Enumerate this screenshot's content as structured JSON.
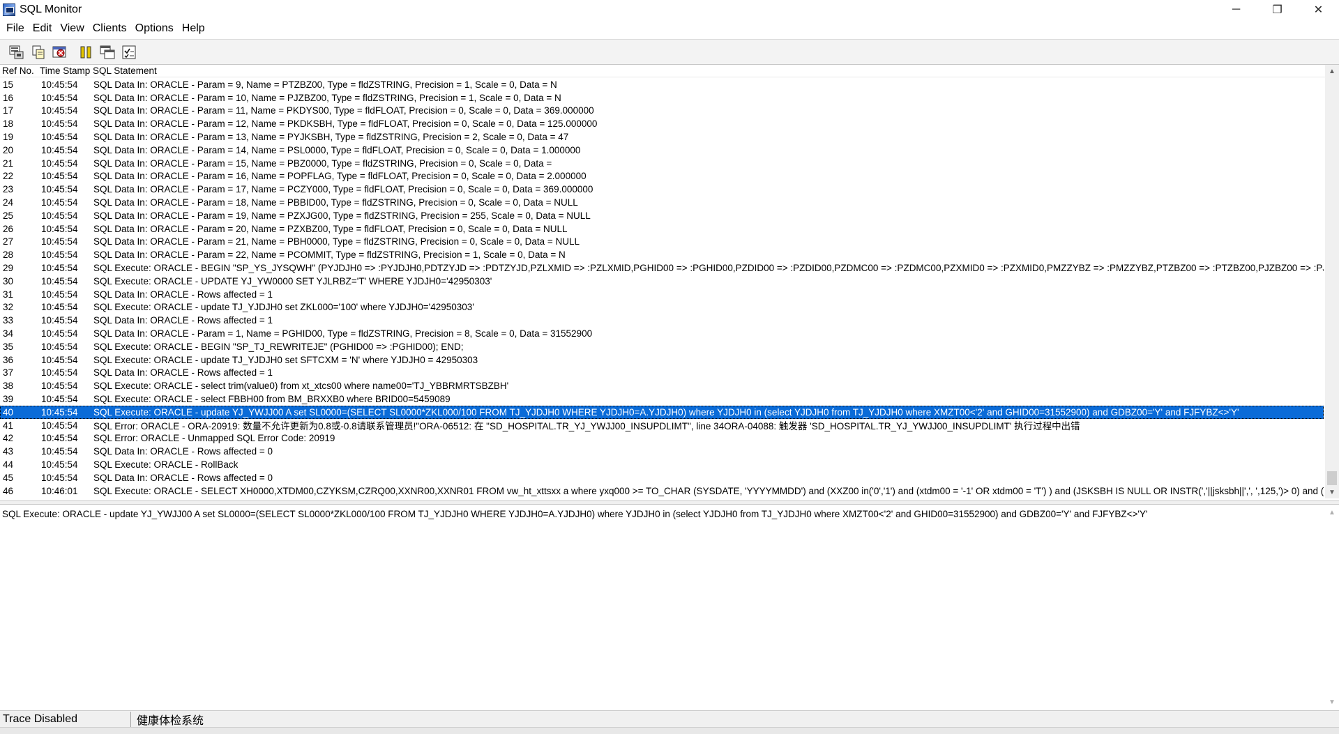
{
  "window": {
    "title": "SQL Monitor",
    "minimize": "─",
    "restore": "❐",
    "close": "✕"
  },
  "menu": [
    "File",
    "Edit",
    "View",
    "Clients",
    "Options",
    "Help"
  ],
  "toolbar": {
    "icons": [
      "save-log-icon",
      "copy-icon",
      "clear-icon",
      "pause-icon",
      "window-icon",
      "options-icon"
    ]
  },
  "list": {
    "columns": {
      "ref": "Ref No.",
      "time": "Time Stamp",
      "sql": "SQL Statement"
    },
    "rows": [
      {
        "ref": "15",
        "time": "10:45:54",
        "sql": "SQL Data In: ORACLE - Param = 9, Name = PTZBZ00, Type = fldZSTRING, Precision = 1, Scale = 0, Data = N"
      },
      {
        "ref": "16",
        "time": "10:45:54",
        "sql": "SQL Data In: ORACLE - Param = 10, Name = PJZBZ00, Type = fldZSTRING, Precision = 1, Scale = 0, Data = N"
      },
      {
        "ref": "17",
        "time": "10:45:54",
        "sql": "SQL Data In: ORACLE - Param = 11, Name = PKDYS00, Type = fldFLOAT, Precision = 0, Scale = 0, Data = 369.000000"
      },
      {
        "ref": "18",
        "time": "10:45:54",
        "sql": "SQL Data In: ORACLE - Param = 12, Name = PKDKSBH, Type = fldFLOAT, Precision = 0, Scale = 0, Data = 125.000000"
      },
      {
        "ref": "19",
        "time": "10:45:54",
        "sql": "SQL Data In: ORACLE - Param = 13, Name = PYJKSBH, Type = fldZSTRING, Precision = 2, Scale = 0, Data = 47"
      },
      {
        "ref": "20",
        "time": "10:45:54",
        "sql": "SQL Data In: ORACLE - Param = 14, Name = PSL0000, Type = fldFLOAT, Precision = 0, Scale = 0, Data = 1.000000"
      },
      {
        "ref": "21",
        "time": "10:45:54",
        "sql": "SQL Data In: ORACLE - Param = 15, Name = PBZ0000, Type = fldZSTRING, Precision = 0, Scale = 0, Data ="
      },
      {
        "ref": "22",
        "time": "10:45:54",
        "sql": "SQL Data In: ORACLE - Param = 16, Name = POPFLAG, Type = fldFLOAT, Precision = 0, Scale = 0, Data = 2.000000"
      },
      {
        "ref": "23",
        "time": "10:45:54",
        "sql": "SQL Data In: ORACLE - Param = 17, Name = PCZY000, Type = fldFLOAT, Precision = 0, Scale = 0, Data = 369.000000"
      },
      {
        "ref": "24",
        "time": "10:45:54",
        "sql": "SQL Data In: ORACLE - Param = 18, Name = PBBID00, Type = fldZSTRING, Precision = 0, Scale = 0, Data = NULL"
      },
      {
        "ref": "25",
        "time": "10:45:54",
        "sql": "SQL Data In: ORACLE - Param = 19, Name = PZXJG00, Type = fldZSTRING, Precision = 255, Scale = 0, Data = NULL"
      },
      {
        "ref": "26",
        "time": "10:45:54",
        "sql": "SQL Data In: ORACLE - Param = 20, Name = PZXBZ00, Type = fldFLOAT, Precision = 0, Scale = 0, Data = NULL"
      },
      {
        "ref": "27",
        "time": "10:45:54",
        "sql": "SQL Data In: ORACLE - Param = 21, Name = PBH0000, Type = fldZSTRING, Precision = 0, Scale = 0, Data = NULL"
      },
      {
        "ref": "28",
        "time": "10:45:54",
        "sql": "SQL Data In: ORACLE - Param = 22, Name = PCOMMIT, Type = fldZSTRING, Precision = 1, Scale = 0, Data = N"
      },
      {
        "ref": "29",
        "time": "10:45:54",
        "sql": "SQL Execute: ORACLE - BEGIN \"SP_YS_JYSQWH\" (PYJDJH0 => :PYJDJH0,PDTZYJD => :PDTZYJD,PZLXMID => :PZLXMID,PGHID00 => :PGHID00,PZDID00 => :PZDID00,PZDMC00 => :PZDMC00,PZXMID0 => :PZXMID0,PMZZYBZ => :PMZZYBZ,PTZBZ00 => :PTZBZ00,PJZBZ00 => :PJZ"
      },
      {
        "ref": "30",
        "time": "10:45:54",
        "sql": "SQL Execute: ORACLE - UPDATE YJ_YW0000 SET YJLRBZ='T' WHERE YJDJH0='42950303'"
      },
      {
        "ref": "31",
        "time": "10:45:54",
        "sql": "SQL Data In: ORACLE - Rows affected = 1"
      },
      {
        "ref": "32",
        "time": "10:45:54",
        "sql": "SQL Execute: ORACLE - update TJ_YJDJH0 set ZKL000='100' where YJDJH0='42950303'"
      },
      {
        "ref": "33",
        "time": "10:45:54",
        "sql": "SQL Data In: ORACLE - Rows affected = 1"
      },
      {
        "ref": "34",
        "time": "10:45:54",
        "sql": "SQL Data In: ORACLE - Param = 1, Name = PGHID00, Type = fldZSTRING, Precision = 8, Scale = 0, Data = 31552900"
      },
      {
        "ref": "35",
        "time": "10:45:54",
        "sql": "SQL Execute: ORACLE - BEGIN \"SP_TJ_REWRITEJE\" (PGHID00 => :PGHID00); END;"
      },
      {
        "ref": "36",
        "time": "10:45:54",
        "sql": "SQL Execute: ORACLE - update TJ_YJDJH0 set SFTCXM = 'N' where YJDJH0 = 42950303"
      },
      {
        "ref": "37",
        "time": "10:45:54",
        "sql": "SQL Data In: ORACLE - Rows affected = 1"
      },
      {
        "ref": "38",
        "time": "10:45:54",
        "sql": "SQL Execute: ORACLE - select trim(value0) from xt_xtcs00 where name00='TJ_YBBRMRTSBZBH'"
      },
      {
        "ref": "39",
        "time": "10:45:54",
        "sql": "SQL Execute: ORACLE - select FBBH00 from BM_BRXXB0 where BRID00=5459089"
      },
      {
        "ref": "40",
        "time": "10:45:54",
        "sql": "SQL Execute: ORACLE -  update YJ_YWJJ00 A set SL0000=(SELECT SL0000*ZKL000/100 FROM TJ_YJDJH0 WHERE YJDJH0=A.YJDJH0)  where YJDJH0 in (select YJDJH0 from TJ_YJDJH0 where XMZT00<'2' and GHID00=31552900)    and GDBZ00='Y' and FJFYBZ<>'Y'"
      },
      {
        "ref": "41",
        "time": "10:45:54",
        "sql": "SQL Error: ORACLE - ORA-20919: 数量不允许更新为0.8或-0.8请联系管理员!\"ORA-06512: 在 \"SD_HOSPITAL.TR_YJ_YWJJ00_INSUPDLIMT\", line 34ORA-04088: 触发器 'SD_HOSPITAL.TR_YJ_YWJJ00_INSUPDLIMT' 执行过程中出错"
      },
      {
        "ref": "42",
        "time": "10:45:54",
        "sql": "SQL Error: ORACLE - Unmapped SQL Error Code: 20919"
      },
      {
        "ref": "43",
        "time": "10:45:54",
        "sql": "SQL Data In: ORACLE - Rows affected = 0"
      },
      {
        "ref": "44",
        "time": "10:45:54",
        "sql": "SQL Execute: ORACLE - RollBack"
      },
      {
        "ref": "45",
        "time": "10:45:54",
        "sql": "SQL Data In: ORACLE - Rows affected = 0"
      },
      {
        "ref": "46",
        "time": "10:46:01",
        "sql": "SQL Execute: ORACLE - SELECT XH0000,XTDM00,CZYKSM,CZRQ00,XXNR00,XXNR01 FROM vw_ht_xttsxx a where yxq000 >= TO_CHAR (SYSDATE, 'YYYYMMDD') and (XXZ00 in('0','1') and (xtdm00 = '-1' OR xtdm00 = 'T') ) and (JSKSBH IS NULL OR INSTR(','||jsksbh||',', ',125,')> 0) and (JSF"
      }
    ],
    "selected_ref": "40"
  },
  "detail": {
    "text": "SQL Execute: ORACLE -  update YJ_YWJJ00 A set SL0000=(SELECT SL0000*ZKL000/100 FROM TJ_YJDJH0 WHERE YJDJH0=A.YJDJH0)  where YJDJH0 in (select YJDJH0 from TJ_YJDJH0 where XMZT00<'2' and GHID00=31552900)    and GDBZ00='Y' and FJFYBZ<>'Y'"
  },
  "status": {
    "trace": "Trace Disabled",
    "app": "健康体检系统"
  },
  "colors": {
    "selection": "#0a6bd8",
    "toolbar_bg": "#f3f3f3"
  }
}
